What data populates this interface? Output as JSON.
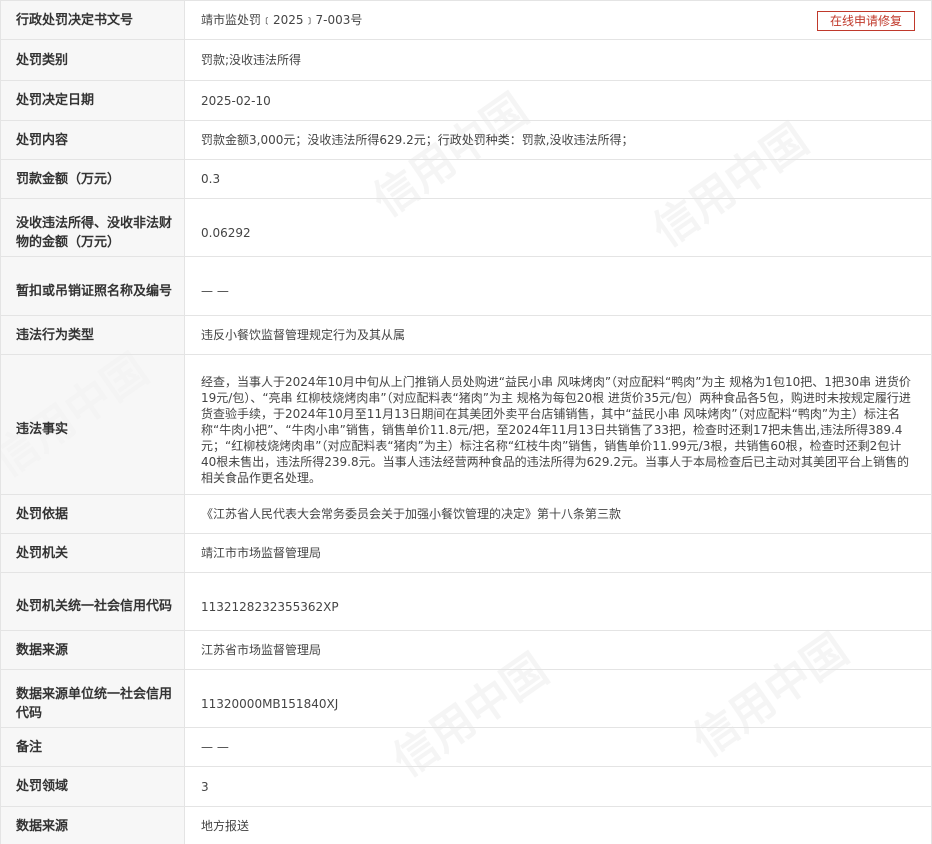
{
  "watermark_text": "信用中国",
  "repair_button_label": "在线申请修复",
  "rows": [
    {
      "label": "行政处罚决定书文号",
      "value": "靖市监处罚﹝2025﹞7-003号"
    },
    {
      "label": "处罚类别",
      "value": "罚款;没收违法所得"
    },
    {
      "label": "处罚决定日期",
      "value": "2025-02-10"
    },
    {
      "label": "处罚内容",
      "value": "罚款金额3,000元；没收违法所得629.2元；行政处罚种类：罚款,没收违法所得；"
    },
    {
      "label": "罚款金额（万元）",
      "value": "0.3"
    },
    {
      "label": "没收违法所得、没收非法财物的金额（万元）",
      "value": "0.06292"
    },
    {
      "label": "暂扣或吊销证照名称及编号",
      "value": "— —"
    },
    {
      "label": "违法行为类型",
      "value": "违反小餐饮监督管理规定行为及其从属"
    },
    {
      "label": "违法事实",
      "value": "经查，当事人于2024年10月中旬从上门推销人员处购进“益民小串 风味烤肉”（对应配料“鸭肉”为主 规格为1包10把、1把30串 进货价19元/包）、“亮串 红柳枝烧烤肉串”（对应配料表“猪肉”为主 规格为每包20根 进货价35元/包）两种食品各5包，购进时未按规定履行进货查验手续，于2024年10月至11月13日期间在其美团外卖平台店铺销售，其中“益民小串 风味烤肉”（对应配料“鸭肉”为主）标注名称“牛肉小把”、“牛肉小串”销售，销售单价11.8元/把，至2024年11月13日共销售了33把，检查时还剩17把未售出,违法所得389.4元；“红柳枝烧烤肉串”（对应配料表“猪肉”为主）标注名称“红枝牛肉”销售，销售单价11.99元/3根，共销售60根，检查时还剩2包计40根未售出，违法所得239.8元。当事人违法经营两种食品的违法所得为629.2元。当事人于本局检查后已主动对其美团平台上销售的相关食品作更名处理。"
    },
    {
      "label": "处罚依据",
      "value": "《江苏省人民代表大会常务委员会关于加强小餐饮管理的决定》第十八条第三款"
    },
    {
      "label": "处罚机关",
      "value": "靖江市市场监督管理局"
    },
    {
      "label": "处罚机关统一社会信用代码",
      "value": "1132128232355362XP"
    },
    {
      "label": "数据来源",
      "value": "江苏省市场监督管理局"
    },
    {
      "label": "数据来源单位统一社会信用代码",
      "value": "11320000MB151840XJ"
    },
    {
      "label": "备注",
      "value": "— —"
    },
    {
      "label": "处罚领域",
      "value": "3"
    },
    {
      "label": "数据来源",
      "value": "地方报送"
    }
  ]
}
